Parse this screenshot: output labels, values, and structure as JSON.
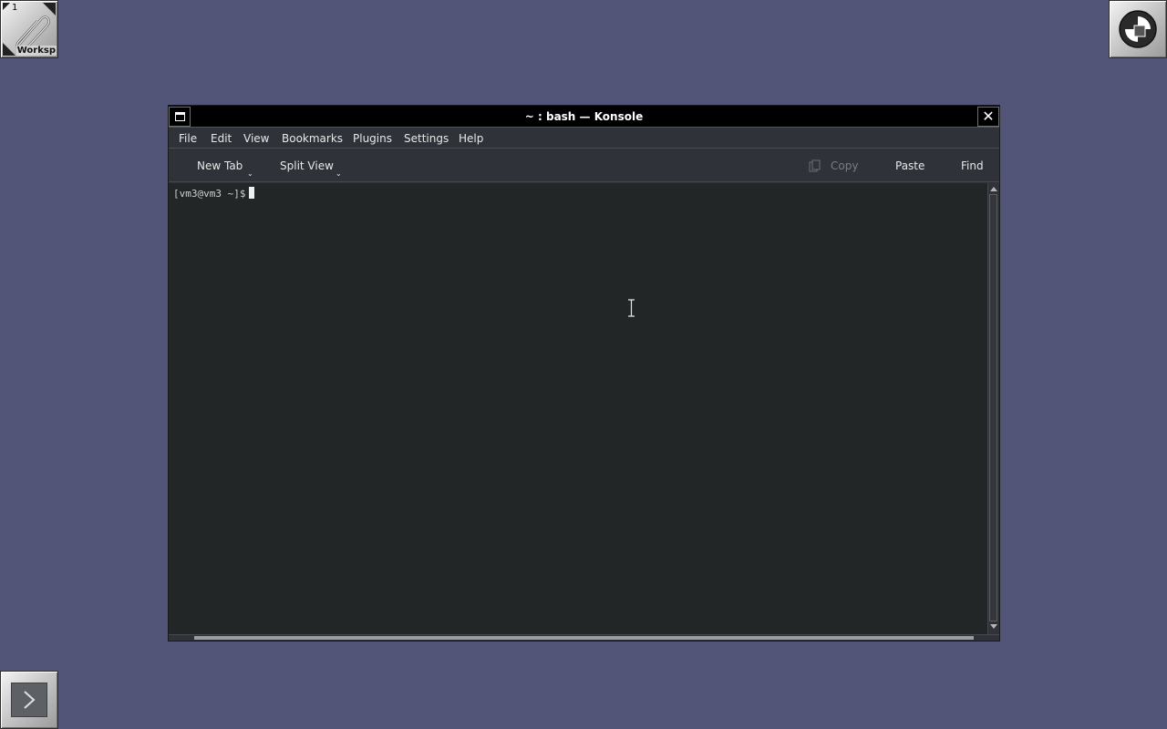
{
  "desktop": {
    "background_color": "#525478",
    "workspace": {
      "number": "1",
      "name": "Worksp",
      "icon": "paperclip-icon"
    },
    "logo": {
      "icon": "wm-logo-icon"
    },
    "launcher": {
      "icon": "chevron-right-icon"
    }
  },
  "window": {
    "title": "~ : bash — Konsole",
    "minimize_icon": "window-menu-icon",
    "close_label": "✕"
  },
  "menubar": {
    "items": [
      "File",
      "Edit",
      "View",
      "Bookmarks",
      "Plugins",
      "Settings",
      "Help"
    ]
  },
  "toolbar": {
    "new_tab": "New Tab",
    "split_view": "Split View",
    "copy": "Copy",
    "paste": "Paste",
    "find": "Find"
  },
  "terminal": {
    "prompt": "[vm3@vm3 ~]$",
    "background": "#232627"
  }
}
